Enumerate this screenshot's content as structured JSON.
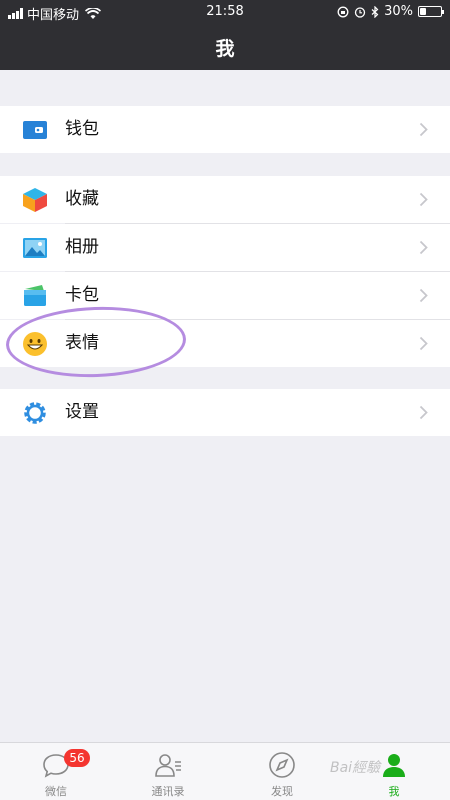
{
  "status": {
    "carrier": "中国移动",
    "time": "21:58",
    "battery": "30%",
    "battery_level": 0.3
  },
  "header": {
    "title": "我"
  },
  "menu": {
    "wallet": "钱包",
    "favorites": "收藏",
    "album": "相册",
    "cards": "卡包",
    "stickers": "表情",
    "settings": "设置"
  },
  "tabs": {
    "chats": "微信",
    "chats_badge": "56",
    "contacts": "通讯录",
    "discover": "发现",
    "me": "我"
  },
  "colors": {
    "accent": "#1aad19",
    "header": "#2f2f33",
    "badge": "#f43530",
    "highlight_circle": "#b58ce0"
  },
  "watermark": "Bai經驗"
}
